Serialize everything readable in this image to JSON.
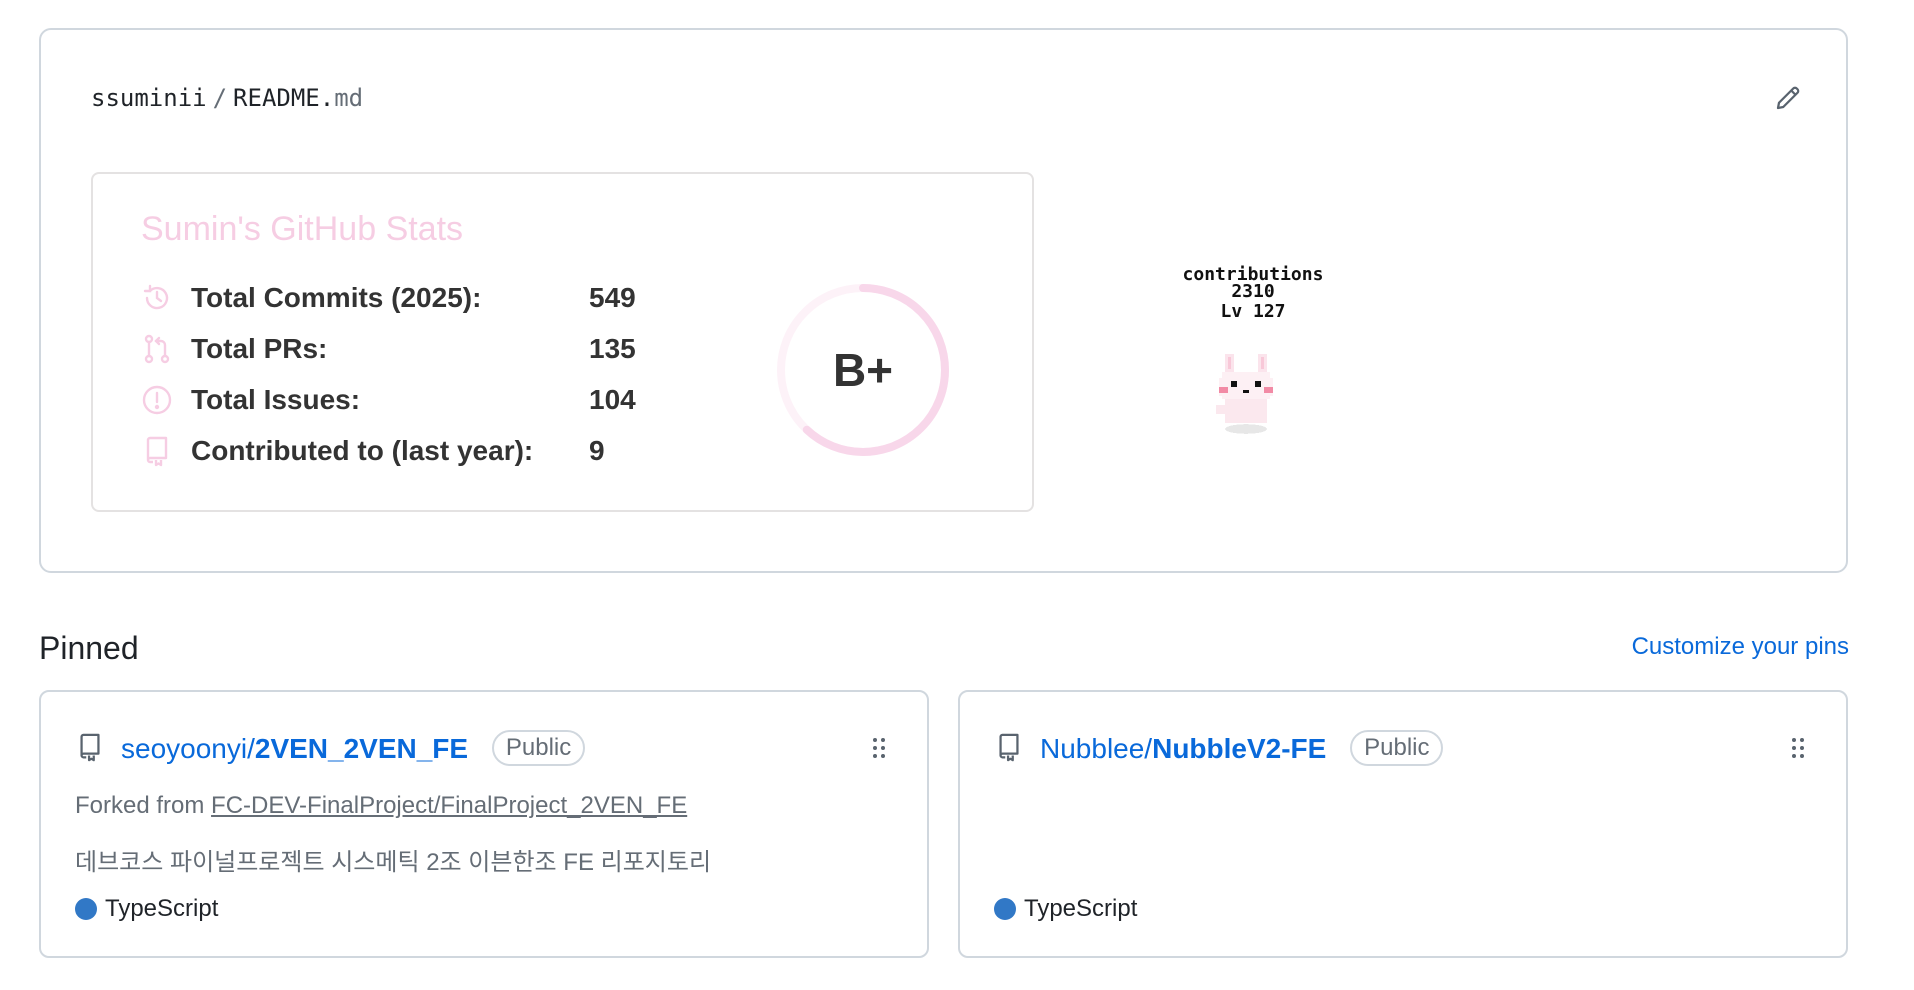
{
  "readme": {
    "owner": "ssuminii",
    "separator": "/",
    "file_base": "README.",
    "file_ext": "md"
  },
  "stats": {
    "title": "Sumin's GitHub Stats",
    "rows": [
      {
        "label": "Total Commits (2025):",
        "value": "549",
        "icon": "history-icon"
      },
      {
        "label": "Total PRs:",
        "value": "135",
        "icon": "pull-request-icon"
      },
      {
        "label": "Total Issues:",
        "value": "104",
        "icon": "issue-icon"
      },
      {
        "label": "Contributed to (last year):",
        "value": "9",
        "icon": "repo-icon"
      }
    ],
    "rank": "B+",
    "rank_progress": 0.62,
    "accent": "#f6cde3"
  },
  "pet": {
    "line1": "contributions",
    "line2": "2310",
    "line3": "Lv 127"
  },
  "pinned": {
    "title": "Pinned",
    "customize_label": "Customize your pins",
    "cards": [
      {
        "owner": "seoyoonyi/",
        "name": "2VEN_2VEN_FE",
        "visibility": "Public",
        "forked_prefix": "Forked from",
        "forked_from": "FC-DEV-FinalProject/FinalProject_2VEN_FE",
        "description": "데브코스 파이널프로젝트 시스메틱 2조 이븐한조 FE 리포지토리",
        "language": "TypeScript",
        "language_color": "#3178c6"
      },
      {
        "owner": "Nubblee/",
        "name": "NubbleV2-FE",
        "visibility": "Public",
        "language": "TypeScript",
        "language_color": "#3178c6"
      }
    ]
  }
}
